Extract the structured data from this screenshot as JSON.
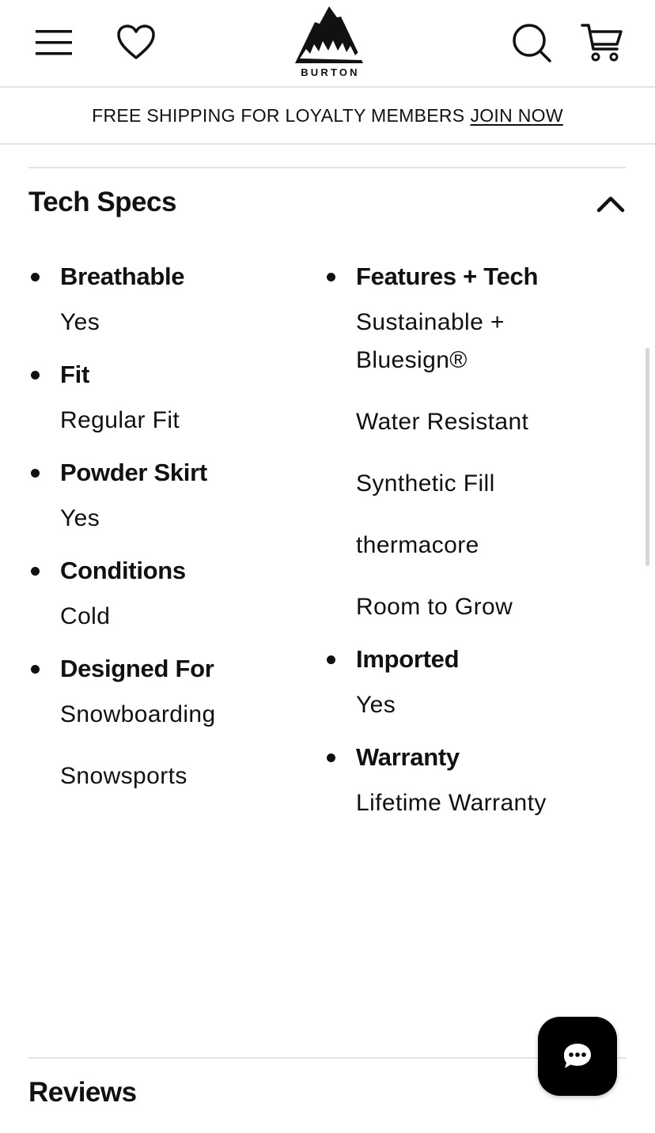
{
  "header": {
    "brand": "BURTON",
    "icons": [
      "menu-icon",
      "heart-icon",
      "burton-mountain-logo",
      "search-icon",
      "cart-icon"
    ]
  },
  "promo": {
    "text": "FREE SHIPPING FOR LOYALTY MEMBERS",
    "link": "JOIN NOW"
  },
  "tech_specs": {
    "title": "Tech Specs",
    "expanded": true,
    "left": [
      {
        "label": "Breathable",
        "values": [
          "Yes"
        ]
      },
      {
        "label": "Fit",
        "values": [
          "Regular Fit"
        ]
      },
      {
        "label": "Powder Skirt",
        "values": [
          "Yes"
        ]
      },
      {
        "label": "Conditions",
        "values": [
          "Cold"
        ]
      },
      {
        "label": "Designed For",
        "values": [
          "Snowboarding",
          "Snowsports"
        ]
      }
    ],
    "right": [
      {
        "label": "Features + Tech",
        "values": [
          "Sustainable + Bluesign®",
          "Water Resistant",
          "Synthetic Fill",
          "thermacore",
          "Room to Grow"
        ]
      },
      {
        "label": "Imported",
        "values": [
          "Yes"
        ]
      },
      {
        "label": "Warranty",
        "values": [
          "Lifetime Warranty"
        ]
      }
    ]
  },
  "reviews": {
    "title": "Reviews"
  },
  "chat": {
    "icon": "chat-bubble-icon"
  },
  "colors": {
    "text": "#111111",
    "divider": "#e3e3e3",
    "chat_bg": "#000000"
  }
}
